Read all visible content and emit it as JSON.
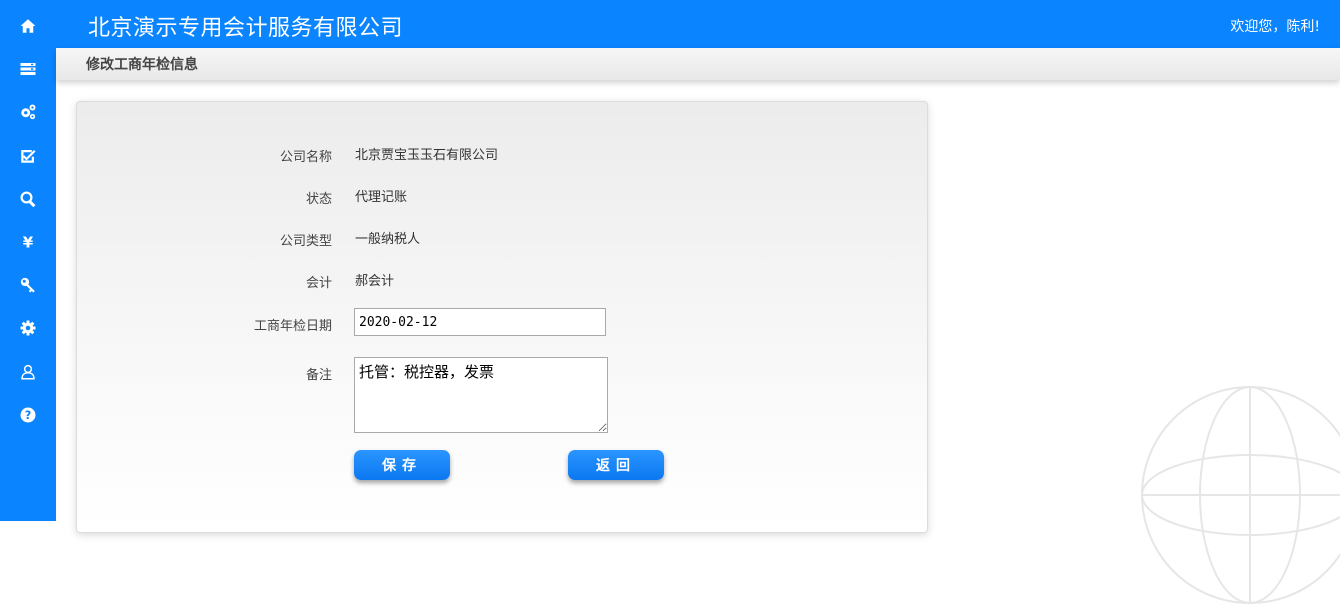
{
  "header": {
    "app_title": "北京演示专用会计服务有限公司",
    "welcome": "欢迎您，陈利!"
  },
  "sidebar": {
    "items": [
      {
        "icon": "home-icon"
      },
      {
        "icon": "list-icon"
      },
      {
        "icon": "gears-icon"
      },
      {
        "icon": "check-square-icon"
      },
      {
        "icon": "search-icon"
      },
      {
        "icon": "yen-icon"
      },
      {
        "icon": "key-icon"
      },
      {
        "icon": "gear-icon"
      },
      {
        "icon": "user-icon"
      },
      {
        "icon": "help-icon"
      }
    ]
  },
  "page": {
    "title": "修改工商年检信息"
  },
  "form": {
    "company_name_label": "公司名称",
    "company_name": "北京贾宝玉玉石有限公司",
    "status_label": "状态",
    "status": "代理记账",
    "company_type_label": "公司类型",
    "company_type": "一般纳税人",
    "accountant_label": "会计",
    "accountant": "郝会计",
    "inspection_date_label": "工商年检日期",
    "inspection_date": "2020-02-12",
    "remark_label": "备注",
    "remark": "托管：税控器，发票"
  },
  "buttons": {
    "save": "保存",
    "back": "返回"
  },
  "colors": {
    "primary": "#0a84ff",
    "background": "#ffffff"
  }
}
